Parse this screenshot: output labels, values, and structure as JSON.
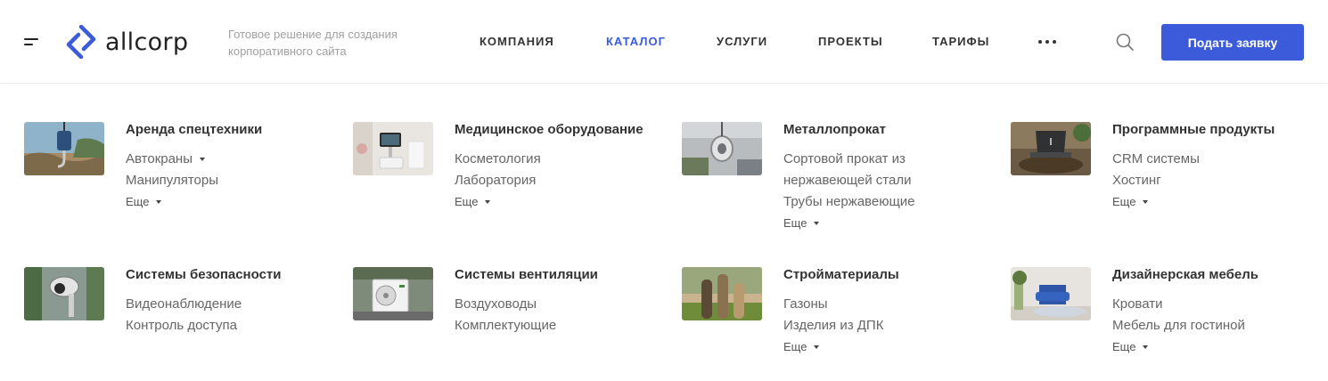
{
  "header": {
    "logo_text": "allcorp",
    "tagline": "Готовое решение для создания корпоративного сайта",
    "nav": [
      {
        "label": "КОМПАНИЯ",
        "active": false
      },
      {
        "label": "КАТАЛОГ",
        "active": true
      },
      {
        "label": "УСЛУГИ",
        "active": false
      },
      {
        "label": "ПРОЕКТЫ",
        "active": false
      },
      {
        "label": "ТАРИФЫ",
        "active": false
      }
    ],
    "more_icon": "more-dots-icon",
    "search_icon": "search-icon",
    "cta_label": "Подать заявку",
    "accent_color": "#3b5bdb"
  },
  "catalog": {
    "more_label": "Еще",
    "categories": [
      {
        "title": "Аренда спецтехники",
        "items": [
          "Автокраны",
          "Манипуляторы"
        ],
        "has_more": true
      },
      {
        "title": "Медицинское оборудование",
        "items": [
          "Косметология",
          "Лаборатория"
        ],
        "has_more": true
      },
      {
        "title": "Металлопрокат",
        "items": [
          "Сортовой прокат из нержавеющей стали",
          "Трубы нержавеющие"
        ],
        "has_more": true
      },
      {
        "title": "Программные продукты",
        "items": [
          "CRM системы",
          "Хостинг"
        ],
        "has_more": true
      },
      {
        "title": "Системы безопасности",
        "items": [
          "Видеонаблюдение",
          "Контроль доступа"
        ],
        "has_more": false
      },
      {
        "title": "Системы вентиляции",
        "items": [
          "Воздуховоды",
          "Комплектующие"
        ],
        "has_more": false
      },
      {
        "title": "Стройматериалы",
        "items": [
          "Газоны",
          "Изделия из ДПК"
        ],
        "has_more": true
      },
      {
        "title": "Дизайнерская мебель",
        "items": [
          "Кровати",
          "Мебель для гостиной"
        ],
        "has_more": true
      }
    ]
  }
}
